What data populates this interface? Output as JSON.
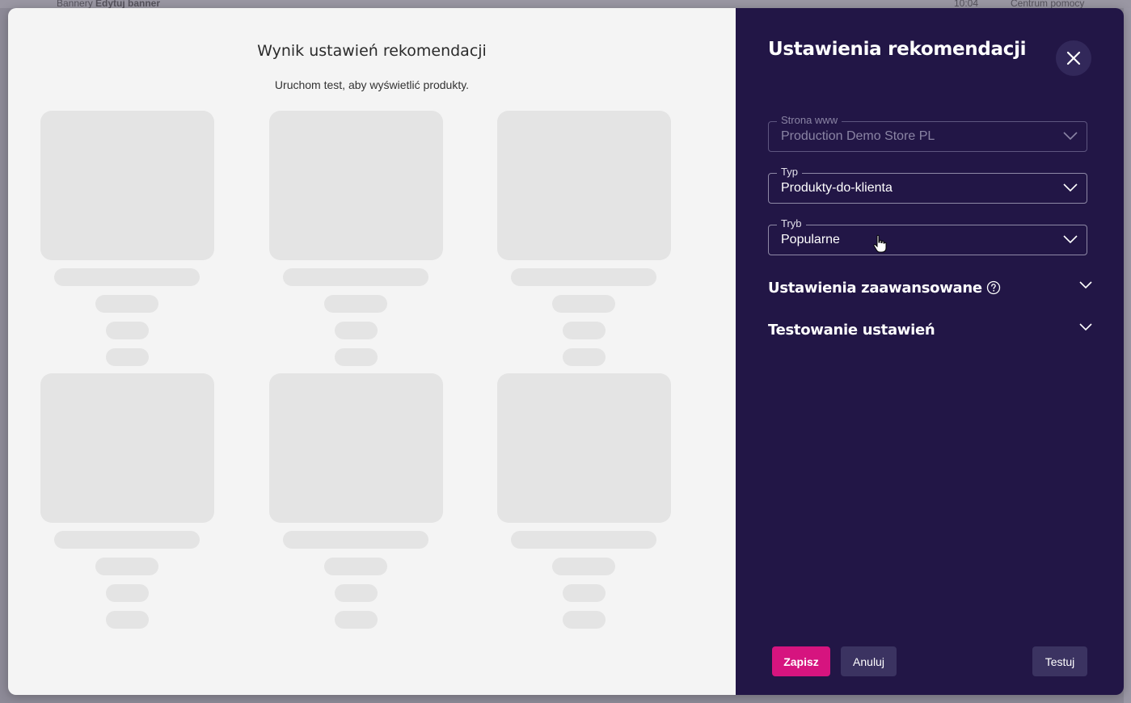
{
  "background": {
    "breadcrumb_prev": "Bannery",
    "breadcrumb_current": "Edytuj banner",
    "time": "10:04",
    "help_center": "Centrum pomocy"
  },
  "preview": {
    "title": "Wynik ustawień rekomendacji",
    "subtitle": "Uruchom test, aby wyświetlić produkty.",
    "placeholder_cards": 6
  },
  "panel": {
    "title": "Ustawienia rekomendacji",
    "fields": [
      {
        "label": "Strona www",
        "value": "Production Demo Store PL",
        "disabled": true
      },
      {
        "label": "Typ",
        "value": "Produkty-do-klienta",
        "disabled": false
      },
      {
        "label": "Tryb",
        "value": "Popularne",
        "disabled": false
      }
    ],
    "sections": [
      {
        "title": "Ustawienia zaawansowane",
        "help_icon": true
      },
      {
        "title": "Testowanie ustawień",
        "help_icon": false
      }
    ],
    "buttons": {
      "save": "Zapisz",
      "cancel": "Anuluj",
      "test": "Testuj"
    }
  },
  "colors": {
    "panel_bg": "#221646",
    "preview_bg": "#f4f4f4",
    "skeleton": "#e4e4e4",
    "accent": "#d6147f",
    "secondary_button": "#3b3361"
  }
}
